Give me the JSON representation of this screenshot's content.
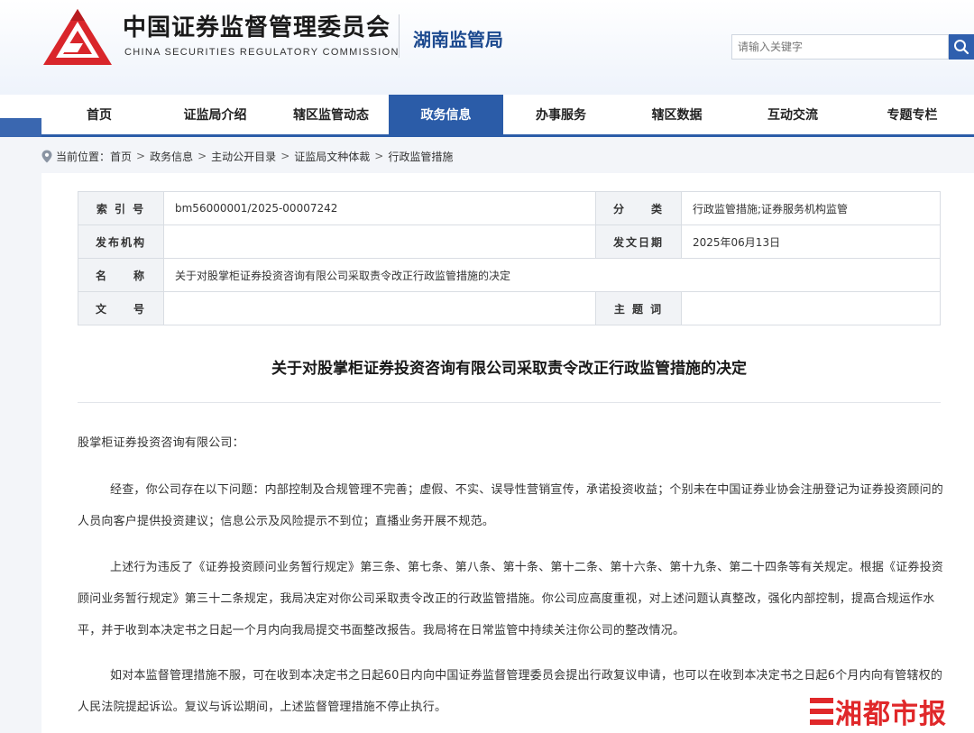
{
  "header": {
    "org_name_cn": "中国证券监督管理委员会",
    "org_name_en": "CHINA SECURITIES REGULATORY COMMISSION",
    "bureau": "湖南监管局",
    "search_placeholder": "请输入关键字",
    "brand_color": "#d9262b",
    "accent_color": "#2b5ca8"
  },
  "nav": {
    "items": [
      {
        "label": "首页",
        "active": false
      },
      {
        "label": "证监局介绍",
        "active": false
      },
      {
        "label": "辖区监管动态",
        "active": false
      },
      {
        "label": "政务信息",
        "active": true
      },
      {
        "label": "办事服务",
        "active": false
      },
      {
        "label": "辖区数据",
        "active": false
      },
      {
        "label": "互动交流",
        "active": false
      },
      {
        "label": "专题专栏",
        "active": false
      }
    ]
  },
  "breadcrumb": {
    "prefix": "当前位置：",
    "items": [
      "首页",
      "政务信息",
      "主动公开目录",
      "证监局文种体裁",
      "行政监管措施"
    ],
    "separator": ">"
  },
  "meta": {
    "index_label": "索 引 号",
    "index_value": "bm56000001/2025-00007242",
    "category_label": "分　　类",
    "category_value": "行政监管措施;证券服务机构监管",
    "issuer_label": "发布机构",
    "issuer_value": "",
    "date_label": "发文日期",
    "date_value": "2025年06月13日",
    "name_label": "名　　称",
    "name_value": "关于对股掌柜证券投资咨询有限公司采取责令改正行政监管措施的决定",
    "docno_label": "文　　号",
    "docno_value": "",
    "keyword_label": "主 题 词",
    "keyword_value": ""
  },
  "document": {
    "title": "关于对股掌柜证券投资咨询有限公司采取责令改正行政监管措施的决定",
    "salutation": "股掌柜证券投资咨询有限公司：",
    "paragraphs": [
      "经查，你公司存在以下问题：内部控制及合规管理不完善；虚假、不实、误导性营销宣传，承诺投资收益；个别未在中国证券业协会注册登记为证券投资顾问的人员向客户提供投资建议；信息公示及风险提示不到位；直播业务开展不规范。",
      "上述行为违反了《证券投资顾问业务暂行规定》第三条、第七条、第八条、第十条、第十二条、第十六条、第十九条、第二十四条等有关规定。根据《证券投资顾问业务暂行规定》第三十二条规定，我局决定对你公司采取责令改正的行政监管措施。你公司应高度重视，对上述问题认真整改，强化内部控制，提高合规运作水平，并于收到本决定书之日起一个月内向我局提交书面整改报告。我局将在日常监管中持续关注你公司的整改情况。",
      "如对本监督管理措施不服，可在收到本决定书之日起60日内向中国证券监督管理委员会提出行政复议申请，也可以在收到本决定书之日起6个月内向有管辖权的人民法院提起诉讼。复议与诉讼期间，上述监督管理措施不停止执行。"
    ]
  },
  "watermark": {
    "text": "湘都市报",
    "color": "#e0282a"
  }
}
